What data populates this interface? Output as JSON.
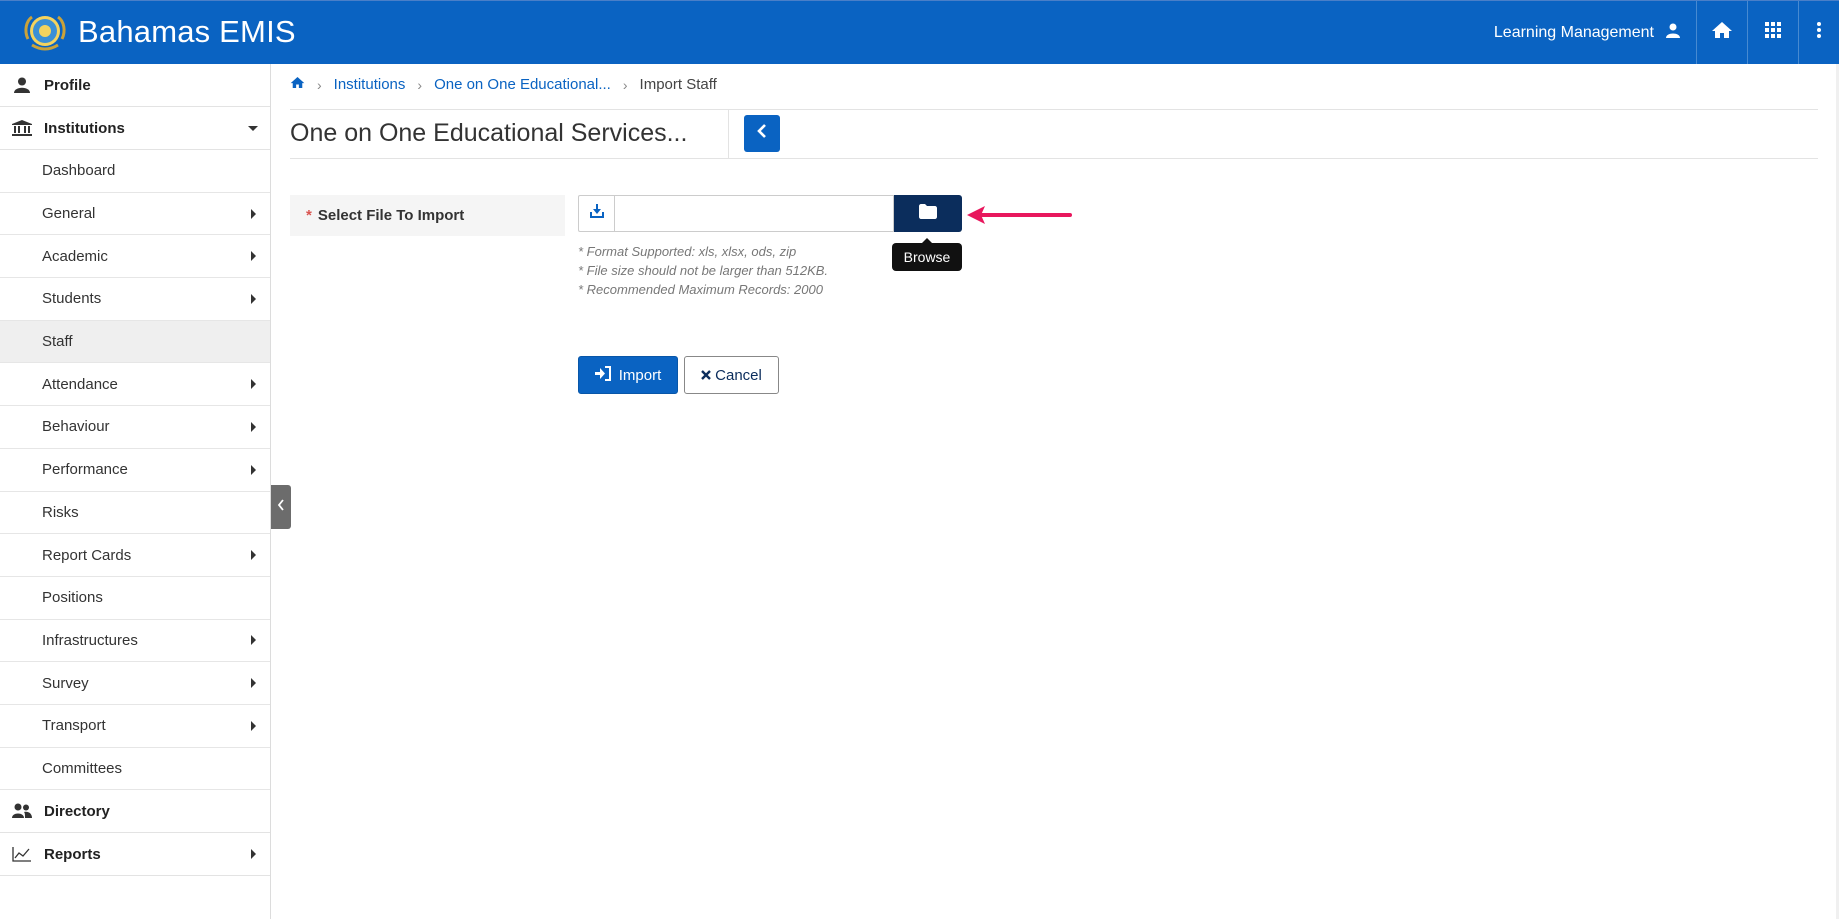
{
  "header": {
    "brand": "Bahamas EMIS",
    "user_label": "Learning Management",
    "icons": [
      "user-icon",
      "home-icon",
      "apps-grid-icon",
      "more-vertical-icon"
    ]
  },
  "sidebar": {
    "profile": "Profile",
    "institutions": "Institutions",
    "items": [
      {
        "label": "Dashboard"
      },
      {
        "label": "General"
      },
      {
        "label": "Academic"
      },
      {
        "label": "Students"
      },
      {
        "label": "Staff"
      },
      {
        "label": "Attendance"
      },
      {
        "label": "Behaviour"
      },
      {
        "label": "Performance"
      },
      {
        "label": "Risks"
      },
      {
        "label": "Report Cards"
      },
      {
        "label": "Positions"
      },
      {
        "label": "Infrastructures"
      },
      {
        "label": "Survey"
      },
      {
        "label": "Transport"
      },
      {
        "label": "Committees"
      }
    ],
    "directory": "Directory",
    "reports": "Reports"
  },
  "breadcrumb": {
    "items": [
      "Institutions",
      "One on One Educational...",
      "Import Staff"
    ]
  },
  "page": {
    "title": "One on One Educational Services..."
  },
  "form": {
    "required_mark": "*",
    "label": "Select File To Import",
    "file_value": "",
    "browse_tooltip": "Browse",
    "hints": [
      "* Format Supported: xls, xlsx, ods, zip",
      "* File size should not be larger than 512KB.",
      "* Recommended Maximum Records: 2000"
    ],
    "import_label": "Import",
    "cancel_label": "Cancel"
  },
  "colors": {
    "header": "#0a63c2",
    "browse": "#0b2d5c",
    "annotation_arrow": "#e8175d"
  }
}
